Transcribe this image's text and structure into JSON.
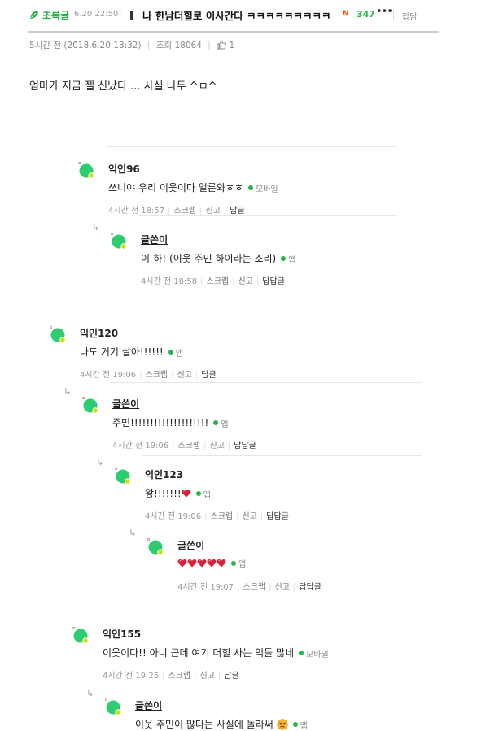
{
  "post": {
    "board_label": "초록글",
    "top_date": "6.20 22:50",
    "title": "나 한남더힐로 이사간다 ㅋㅋㅋㅋㅋㅋㅋㅋㅋ",
    "badge_new": "N",
    "comment_count": "347",
    "more_label": "•••",
    "talk_label": "잡담",
    "posted_ago": "5시간 전",
    "posted_at": "(2018.6.20 18:32)",
    "views": "조회 18064",
    "likes": "1",
    "body": "엄마가 지금 젤 신났다 ... 사실 나두 ^ㅁ^"
  },
  "comments": [
    {
      "nick": "익인96",
      "text": "쓰니야 우리 이웃이다 얼른와ㅎㅎ",
      "device": "모바일",
      "time": "4시간 전 18:57",
      "scrap": "스크랩",
      "report": "신고",
      "reply": "답글",
      "author": false,
      "level": 1
    },
    {
      "nick": "글쓴이",
      "text": "이-하! (이웃 주민 하이라는 소리)",
      "device": "앱",
      "time": "4시간 전 18:58",
      "scrap": "스크랩",
      "report": "신고",
      "reply": "답답글",
      "author": true,
      "level": 2
    },
    {
      "nick": "익인120",
      "text": "나도 거기 살아!!!!!!",
      "device": "앱",
      "time": "4시간 전 19:06",
      "scrap": "스크랩",
      "report": "신고",
      "reply": "답글",
      "author": false,
      "level": 0
    },
    {
      "nick": "글쓴이",
      "text": "주민!!!!!!!!!!!!!!!!!!!!",
      "device": "앱",
      "time": "4시간 전 19:06",
      "scrap": "스크랩",
      "report": "신고",
      "reply": "답답글",
      "author": true,
      "level": 1
    },
    {
      "nick": "익인123",
      "text": "왕!!!!!!!",
      "device": "앱",
      "time": "4시간 전 19:06",
      "scrap": "스크랩",
      "report": "신고",
      "reply": "답답글",
      "author": false,
      "level": 2
    },
    {
      "nick": "글쓴이",
      "text": "",
      "device": "앱",
      "time": "4시간 전 19:07",
      "scrap": "스크랩",
      "report": "신고",
      "reply": "답답글",
      "author": true,
      "level": 3
    },
    {
      "nick": "익인155",
      "text": "이웃이다!! 아니 근데 여기 더힐 사는 익들 많네",
      "device": "모바일",
      "time": "4시간 전 19:25",
      "scrap": "스크랩",
      "report": "신고",
      "reply": "답글",
      "author": false,
      "level": 1
    },
    {
      "nick": "글쓴이",
      "text": "이웃 주민이 많다는 사실에 놀라써",
      "device": "앱",
      "time": "",
      "scrap": "",
      "report": "",
      "reply": "",
      "author": true,
      "level": 2
    }
  ],
  "colors": {
    "accent": "#2bb24c",
    "avatar": "#2ecc71",
    "heart": "#d6223a"
  }
}
